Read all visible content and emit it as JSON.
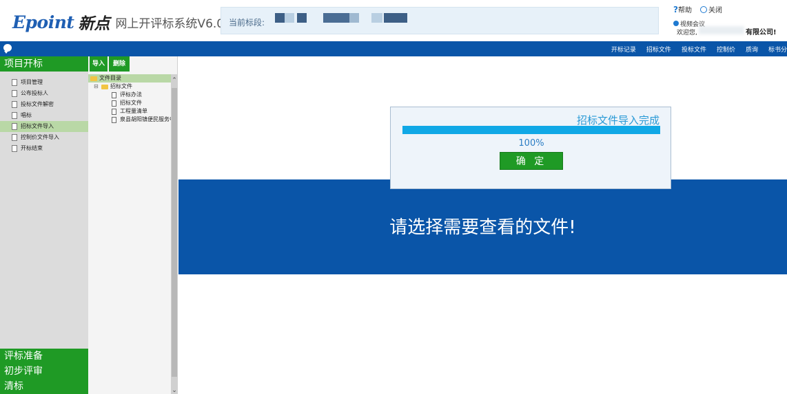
{
  "header": {
    "brand_en": "Epoint",
    "brand_cn": "新点",
    "system_name": "网上开评标系统V6.0",
    "stage_label": "当前标段:",
    "help": "帮助",
    "close": "关闭",
    "video_meeting": "视频会议",
    "welcome": "欢迎您,",
    "company_suffix": "有限公司!"
  },
  "nav": {
    "items": [
      "开标记录",
      "招标文件",
      "投标文件",
      "控制价",
      "质询",
      "标书分"
    ]
  },
  "left_menu": {
    "section_top": "项目开标",
    "items": [
      {
        "label": "项目管理"
      },
      {
        "label": "公布投标人"
      },
      {
        "label": "投标文件解密"
      },
      {
        "label": "唱标"
      },
      {
        "label": "招标文件导入"
      },
      {
        "label": "控制价文件导入"
      },
      {
        "label": "开标结束"
      }
    ],
    "sections_bottom": [
      "评标准备",
      "初步评审",
      "清标"
    ]
  },
  "tree_panel": {
    "import_btn": "导入",
    "delete_btn": "删除",
    "root": "文件目录",
    "folder": "招标文件",
    "files": [
      "评标办法",
      "招标文件",
      "工程量清单",
      "泉县胡阳镇便民服务中"
    ]
  },
  "main": {
    "prompt": "请选择需要查看的文件!"
  },
  "dialog": {
    "title": "招标文件导入完成",
    "progress_percent": 100,
    "progress_text": "100%",
    "confirm": "确 定"
  },
  "colors": {
    "nav_blue": "#0a55a8",
    "green": "#1f9a25",
    "progress": "#10a8e6"
  }
}
